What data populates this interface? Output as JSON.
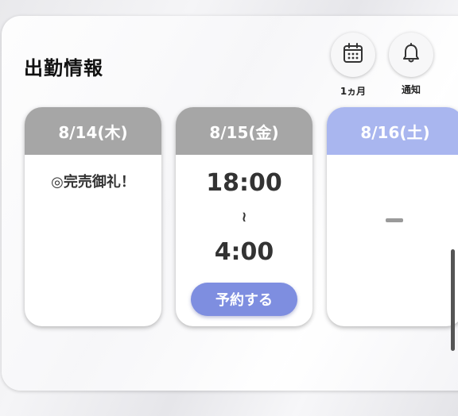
{
  "header": {
    "title": "出勤情報"
  },
  "actions": [
    {
      "icon": "calendar-icon",
      "label": "1ヵ月"
    },
    {
      "icon": "bell-icon",
      "label": "通知"
    }
  ],
  "cards": [
    {
      "date": "8/14(木)",
      "note": "◎完売御礼！",
      "head_color": "#a6a6a6"
    },
    {
      "date": "8/15(金)",
      "start": "18:00",
      "separator": "≀",
      "end": "4:00",
      "button": "予約する",
      "head_color": "#a6a6a6"
    },
    {
      "date": "8/16(土)",
      "head_color": "#a9b6ef"
    }
  ],
  "colors": {
    "accent": "#7e8ee0",
    "saturday": "#a9b6ef",
    "weekday": "#a6a6a6"
  }
}
